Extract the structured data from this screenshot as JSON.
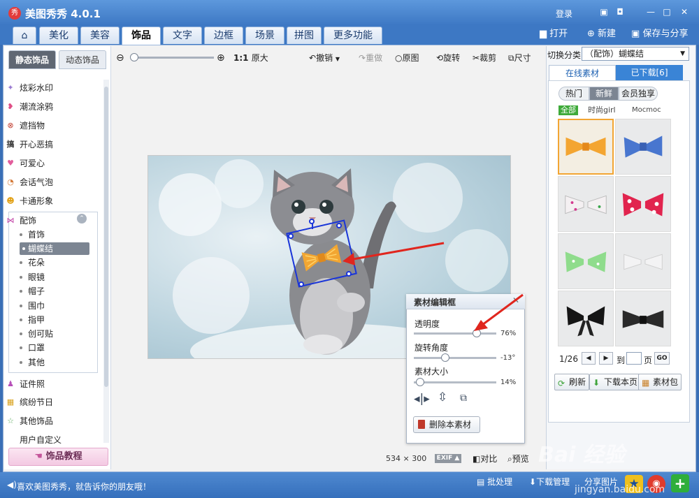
{
  "app": {
    "title": "美图秀秀 4.0.1",
    "logo_char": "秀",
    "login": "登录"
  },
  "window": {
    "icons": [
      "comment-icon",
      "skin-icon",
      "minimize-icon",
      "maximize-icon",
      "close-icon"
    ]
  },
  "tabs": [
    {
      "label": "美化"
    },
    {
      "label": "美容"
    },
    {
      "label": "饰品"
    },
    {
      "label": "文字"
    },
    {
      "label": "边框"
    },
    {
      "label": "场景"
    },
    {
      "label": "拼图"
    },
    {
      "label": "更多功能"
    }
  ],
  "header_actions": {
    "open": "打开",
    "new": "新建",
    "save_share": "保存与分享"
  },
  "left": {
    "subtabs": [
      "静态饰品",
      "动态饰品"
    ],
    "categories": [
      "炫彩水印",
      "潮流涂鸦",
      "遮挡物",
      "开心恶搞",
      "可爱心",
      "会话气泡",
      "卡通形象",
      "配饰"
    ],
    "accessories": [
      "首饰",
      "蝴蝶结",
      "花朵",
      "眼镜",
      "帽子",
      "围巾",
      "指甲",
      "创可贴",
      "口罩",
      "其他"
    ],
    "categories_bottom": [
      "证件照",
      "缤纷节日",
      "其他饰品",
      "用户自定义"
    ],
    "tutorial": "饰品教程"
  },
  "toolbar": {
    "ratio": "1:1",
    "original_size": "原大",
    "undo": "撤销",
    "redo": "重做",
    "original": "原图",
    "rotate": "旋转",
    "crop": "裁剪",
    "size": "尺寸"
  },
  "canvas": {
    "width": "534",
    "height": "300",
    "exif": "EXIF",
    "compare": "对比",
    "preview": "预览"
  },
  "editor": {
    "title": "素材编辑框",
    "opacity_label": "透明度",
    "opacity_value": "76%",
    "opacity": 0.76,
    "rotate_label": "旋转角度",
    "rotate_value": "-13°",
    "rotate": -13,
    "size_label": "素材大小",
    "size_value": "14%",
    "size": 0.14,
    "delete": "删除本素材"
  },
  "right": {
    "switch_label": "切换分类",
    "switch_value": "（配饰）蝴蝶结",
    "tabs": [
      "在线素材",
      "已下载[6]"
    ],
    "pills": [
      "热门",
      "新鲜",
      "会员独享"
    ],
    "filters": [
      "全部",
      "时尚girl",
      "Mocmoc"
    ],
    "page_current": "1/26",
    "page_to": "到",
    "page_unit": "页",
    "go": "GO",
    "refresh": "刷新",
    "download_page": "下载本页",
    "package": "素材包"
  },
  "bottom": {
    "message": "喜欢美图秀秀，就告诉你的朋友哦！",
    "batch": "批处理",
    "downloader": "下载管理",
    "share_image": "分享图片"
  },
  "watermark": {
    "text": "Bai 经验",
    "url": "jingyan.baidu.com"
  },
  "colors": {
    "accent": "#3d78c4",
    "selection": "#1a35d8",
    "arrow": "#e0261e"
  }
}
